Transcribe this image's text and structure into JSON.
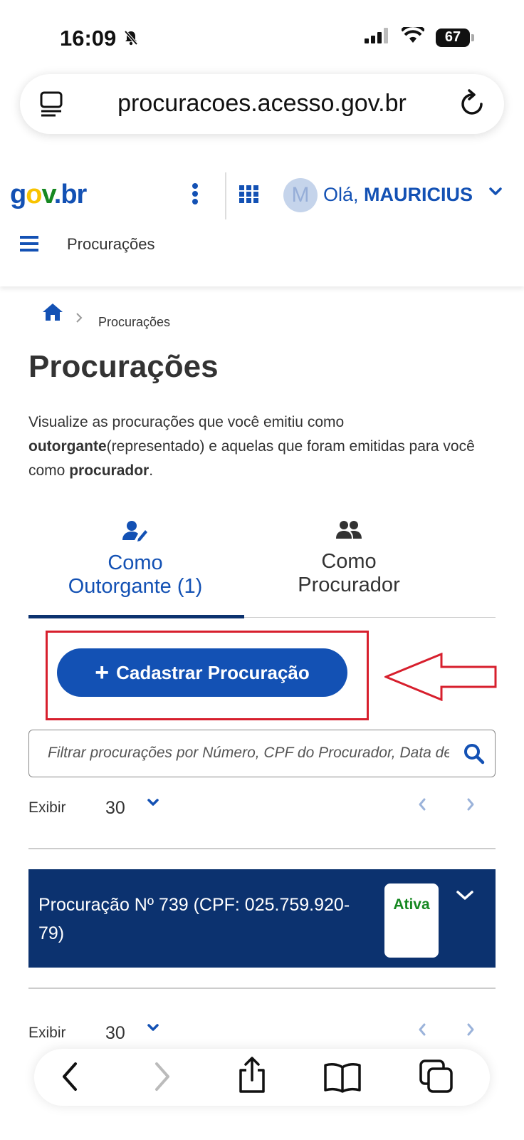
{
  "status_bar": {
    "time": "16:09",
    "battery": "67"
  },
  "browser": {
    "url": "procuracoes.acesso.gov.br"
  },
  "header": {
    "logo": {
      "part1": "g",
      "part2": "o",
      "part3": "v",
      "part4": ".",
      "part5": "br"
    },
    "avatar_letter": "M",
    "greeting_prefix": "Olá, ",
    "user_name": "MAURICIUS",
    "section_title": "Procurações"
  },
  "breadcrumb": {
    "current": "Procurações"
  },
  "page": {
    "title": "Procurações",
    "desc_1": "Visualize as procurações que você emitiu como ",
    "desc_bold_1": "outorgante",
    "desc_2": "(representado) e aquelas que foram emitidas para você como ",
    "desc_bold_2": "procurador",
    "desc_3": "."
  },
  "tabs": [
    {
      "line1": "Como",
      "line2": "Outorgante (1)",
      "active": true
    },
    {
      "line1": "Como",
      "line2": "Procurador",
      "active": false
    }
  ],
  "actions": {
    "add_label": "Cadastrar Procuração"
  },
  "search": {
    "placeholder": "Filtrar procurações por Número, CPF do Procurador, Data de Emissão"
  },
  "pager": {
    "label": "Exibir",
    "page_size": "30"
  },
  "cards": [
    {
      "title": "Procuração Nº 739 (CPF: 025.759.920-79)",
      "status": "Ativa"
    }
  ],
  "colors": {
    "primary": "#1351b4",
    "primary_dark": "#0c326f",
    "success": "#168821",
    "annotation": "#d71f2d"
  }
}
